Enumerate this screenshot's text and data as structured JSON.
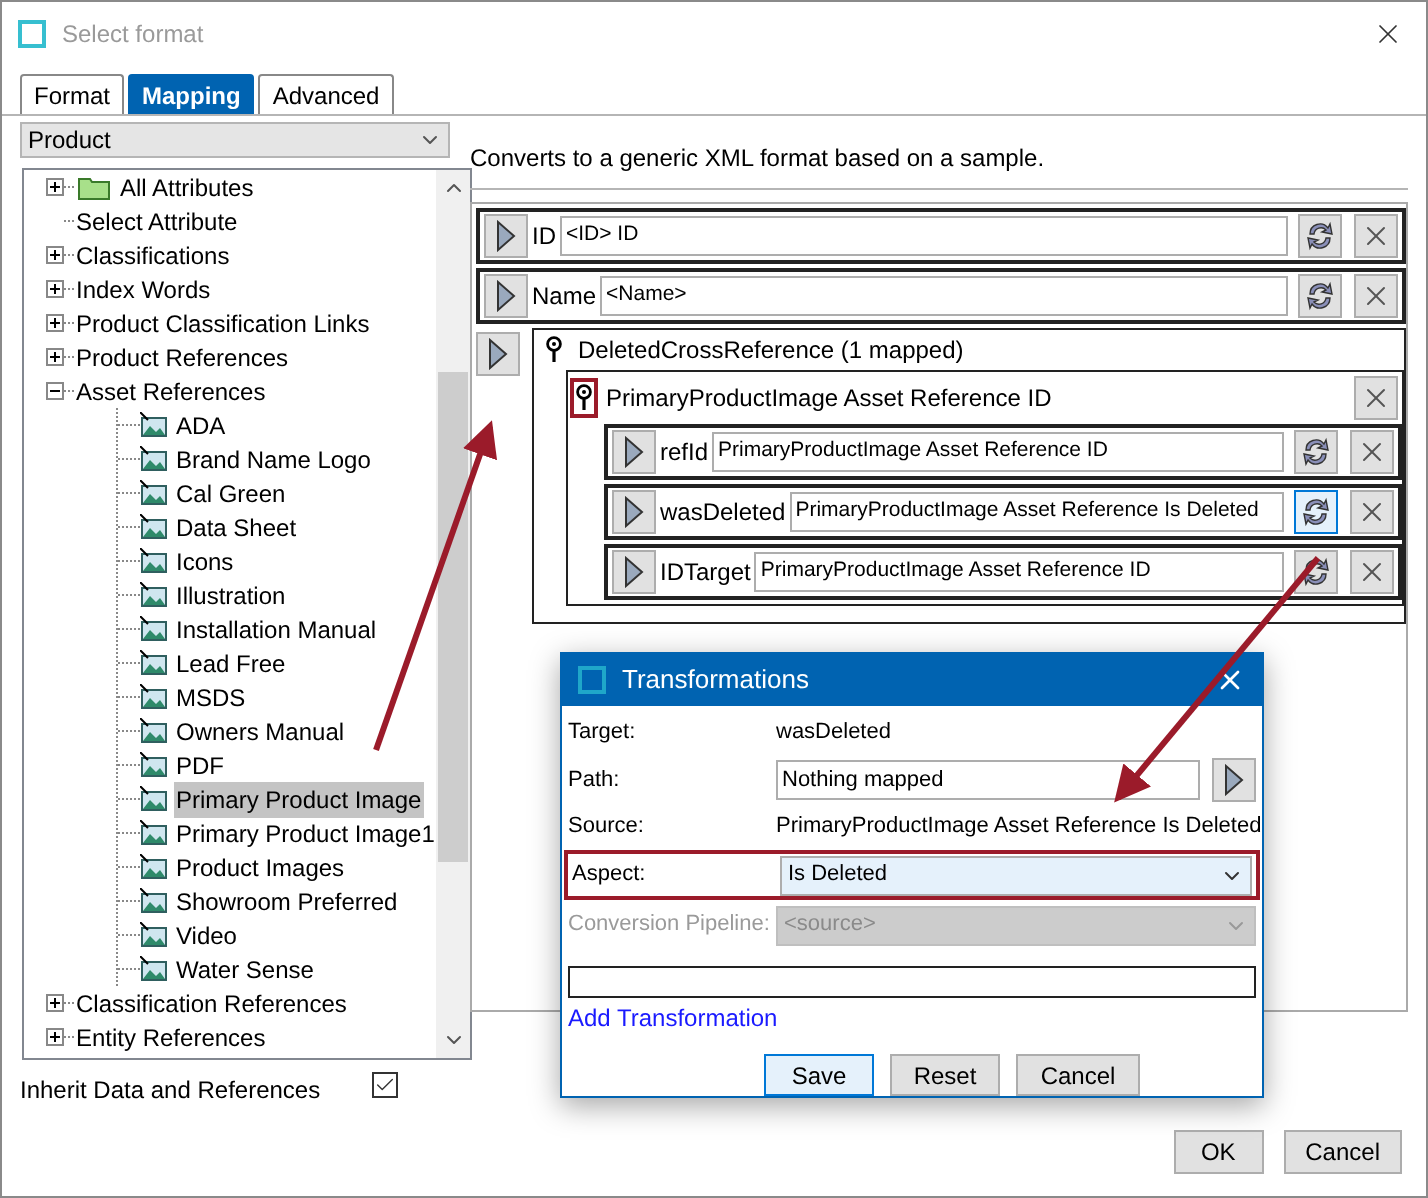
{
  "window": {
    "title": "Select format"
  },
  "tabs": [
    {
      "label": "Format",
      "selected": false
    },
    {
      "label": "Mapping",
      "selected": true
    },
    {
      "label": "Advanced",
      "selected": false
    }
  ],
  "object_type": {
    "value": "Product"
  },
  "tree": [
    {
      "label": "All Attributes",
      "kind": "folder",
      "expanded": false,
      "selected": false
    },
    {
      "label": "Select Attribute",
      "kind": "leaf",
      "selected": false
    },
    {
      "label": "Classifications",
      "kind": "group",
      "expanded": false,
      "selected": false
    },
    {
      "label": "Index Words",
      "kind": "group",
      "expanded": false,
      "selected": false
    },
    {
      "label": "Product Classification Links",
      "kind": "group",
      "expanded": false,
      "selected": false
    },
    {
      "label": "Product References",
      "kind": "group",
      "expanded": false,
      "selected": false
    },
    {
      "label": "Asset References",
      "kind": "group",
      "expanded": true,
      "selected": false,
      "children": [
        {
          "label": "ADA",
          "selected": false
        },
        {
          "label": "Brand Name Logo",
          "selected": false
        },
        {
          "label": "Cal Green",
          "selected": false
        },
        {
          "label": "Data Sheet",
          "selected": false
        },
        {
          "label": "Icons",
          "selected": false
        },
        {
          "label": "Illustration",
          "selected": false
        },
        {
          "label": "Installation Manual",
          "selected": false
        },
        {
          "label": "Lead Free",
          "selected": false
        },
        {
          "label": "MSDS",
          "selected": false
        },
        {
          "label": "Owners Manual",
          "selected": false
        },
        {
          "label": "PDF",
          "selected": false
        },
        {
          "label": "Primary Product Image",
          "selected": true
        },
        {
          "label": "Primary Product Image1",
          "selected": false
        },
        {
          "label": "Product Images",
          "selected": false
        },
        {
          "label": "Showroom Preferred",
          "selected": false
        },
        {
          "label": "Video",
          "selected": false
        },
        {
          "label": "Water Sense",
          "selected": false
        }
      ]
    },
    {
      "label": "Classification References",
      "kind": "group",
      "expanded": false,
      "selected": false
    },
    {
      "label": "Entity References",
      "kind": "group",
      "expanded": false,
      "selected": false
    }
  ],
  "inherit": {
    "label": "Inherit Data and References",
    "checked": true
  },
  "description": "Converts to a generic XML format based on a sample.",
  "mappings": [
    {
      "kind": "field",
      "label": "ID",
      "value": "<ID> ID",
      "focused": false
    },
    {
      "kind": "field",
      "label": "Name",
      "value": "<Name>",
      "focused": false
    },
    {
      "kind": "group",
      "label": "DeletedCrossReference (1 mapped)",
      "highlighted": false,
      "children": [
        {
          "kind": "group",
          "label": "PrimaryProductImage Asset Reference ID",
          "highlighted": true,
          "children": [
            {
              "kind": "field",
              "label": "refId",
              "value": "PrimaryProductImage Asset Reference ID",
              "focused": false
            },
            {
              "kind": "field",
              "label": "wasDeleted",
              "value": "PrimaryProductImage Asset Reference Is Deleted",
              "focused": true
            },
            {
              "kind": "field",
              "label": "IDTarget",
              "value": "PrimaryProductImage Asset Reference ID",
              "focused": false
            }
          ]
        }
      ]
    }
  ],
  "transformations": {
    "title": "Transformations",
    "fields": [
      {
        "kind": "text",
        "label": "Target:",
        "value": "wasDeleted"
      },
      {
        "kind": "path",
        "label": "Path:",
        "value": "Nothing mapped"
      },
      {
        "kind": "text",
        "label": "Source:",
        "value": "PrimaryProductImage Asset Reference Is Deleted"
      },
      {
        "kind": "select",
        "label": "Aspect:",
        "value": "Is Deleted",
        "disabled": false,
        "highlighted": true
      },
      {
        "kind": "select",
        "label": "Conversion Pipeline:",
        "value": "<source>",
        "disabled": true,
        "highlighted": false
      }
    ],
    "link": "Add Transformation",
    "buttons": [
      {
        "label": "Save",
        "default": true
      },
      {
        "label": "Reset",
        "default": false
      },
      {
        "label": "Cancel",
        "default": false
      }
    ]
  },
  "buttons": [
    {
      "label": "OK"
    },
    {
      "label": "Cancel"
    }
  ]
}
